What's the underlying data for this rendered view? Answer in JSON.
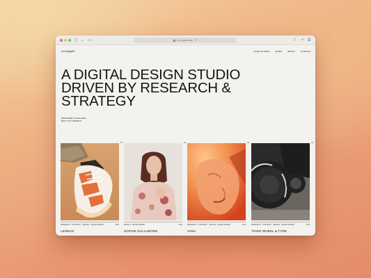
{
  "browser": {
    "url": "dunnigital.studio",
    "icons": {
      "sidebar": "sidebar-toggle-icon",
      "tabs": "tab-overview-icon",
      "share": "share-icon",
      "new_tab": "plus-icon",
      "tab_overview": "copy-icon"
    }
  },
  "site": {
    "logo": "DunnDigital®",
    "nav": [
      "CASE STUDIES",
      "WORK",
      "ABOUT",
      "CONTACT"
    ],
    "headline": [
      "A DIGITAL DESIGN STUDIO",
      "DRIVEN BY RESEARCH &",
      "STRATEGY"
    ],
    "subline": [
      "DESIGNED TO ENGAGE",
      "BUILT TO CONNECT"
    ]
  },
  "projects": [
    {
      "counter": "01",
      "tags": "RESEARCH · STRATEGY · DESIGN · DEVELOPMENT",
      "year": "2024",
      "name": "LEMKUS"
    },
    {
      "counter": "02",
      "tags": "DESIGN · DEVELOPMENT",
      "year": "2024",
      "name": "SOPHIE DALLAMORE"
    },
    {
      "counter": "03",
      "tags": "RESEARCH · STRATEGY · DESIGN · DEVELOPMENT",
      "year": "2024",
      "name": "VANA"
    },
    {
      "counter": "04",
      "tags": "RESEARCH · STRATEGY · DESIGN · DEVELOPMENT",
      "year": "2024",
      "name": "TIGER WHEEL & TYRE"
    }
  ],
  "colors": {
    "page_background": "#f3f2ef",
    "text": "#151515",
    "backdrop_warm": "#eeb385"
  }
}
